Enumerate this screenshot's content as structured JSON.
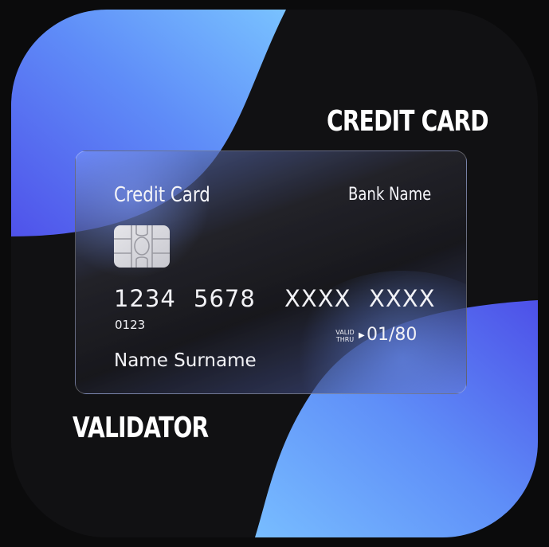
{
  "headings": {
    "top": "CREDIT CARD",
    "bottom": "VALIDATOR"
  },
  "card": {
    "title": "Credit Card",
    "bank_name": "Bank Name",
    "number_groups": [
      "1234",
      "5678",
      "XXXX",
      "XXXX"
    ],
    "small_number": "0123",
    "valid_label_line1": "VALID",
    "valid_label_line2": "THRU",
    "valid_arrow": "▶",
    "expiry": "01/80",
    "holder": "Name Surname"
  },
  "icons": {
    "chip": "card-chip-icon"
  },
  "colors": {
    "background": "#0b0b0c",
    "tile": "#111113",
    "blob_light": "#72b8ff",
    "blob_dark": "#4f5ef0",
    "text": "#ffffff"
  }
}
